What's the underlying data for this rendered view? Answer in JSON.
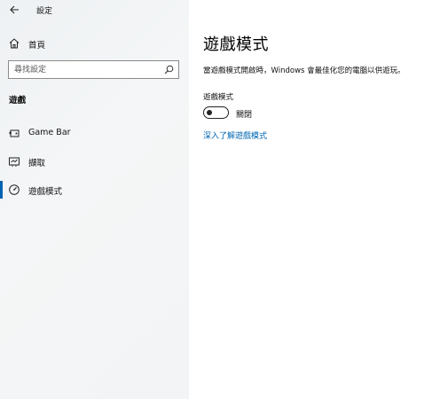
{
  "window": {
    "title": "設定"
  },
  "sidebar": {
    "home_label": "首頁",
    "search": {
      "placeholder": "尋找設定"
    },
    "section_title": "遊戲",
    "items": [
      {
        "label": "Game Bar",
        "icon": "game-bar-icon",
        "selected": false
      },
      {
        "label": "擷取",
        "icon": "capture-icon",
        "selected": false
      },
      {
        "label": "遊戲模式",
        "icon": "game-mode-icon",
        "selected": true
      }
    ]
  },
  "main": {
    "title": "遊戲模式",
    "description": "當遊戲模式開啟時，Windows 會最佳化您的電腦以供遊玩。",
    "setting": {
      "label": "遊戲模式",
      "state": "關閉",
      "on": false
    },
    "learn_more_link": "深入了解遊戲模式"
  },
  "colors": {
    "accent": "#0063b1",
    "link": "#0066b4",
    "sidebar_bg": "#f2f4f5"
  }
}
